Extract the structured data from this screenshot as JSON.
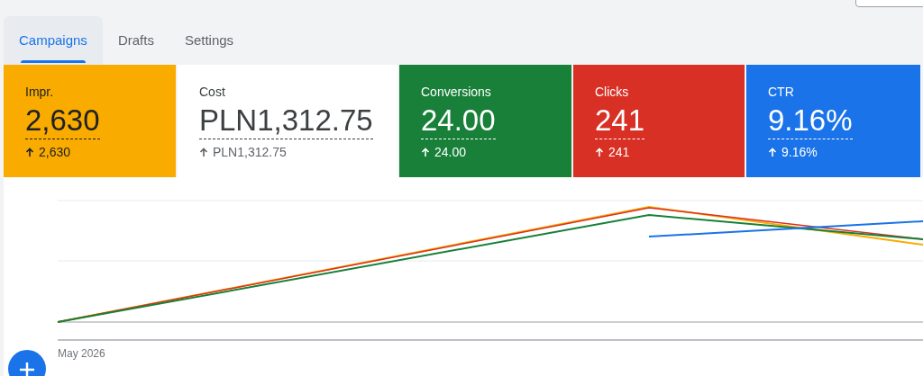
{
  "tabs": [
    {
      "label": "Campaigns",
      "selected": true
    },
    {
      "label": "Drafts",
      "selected": false
    },
    {
      "label": "Settings",
      "selected": false
    }
  ],
  "metrics": [
    {
      "label": "Impr.",
      "value": "2,630",
      "change": "2,630",
      "color": "#f9ab00"
    },
    {
      "label": "Cost",
      "value": "PLN1,312.75",
      "change": "PLN1,312.75",
      "color": "#ffffff"
    },
    {
      "label": "Conversions",
      "value": "24.00",
      "change": "24.00",
      "color": "#188038"
    },
    {
      "label": "Clicks",
      "value": "241",
      "change": "241",
      "color": "#d93025"
    },
    {
      "label": "CTR",
      "value": "9.16%",
      "change": "9.16%",
      "color": "#1a73e8"
    }
  ],
  "chart": {
    "x_label": "May 2026"
  }
}
